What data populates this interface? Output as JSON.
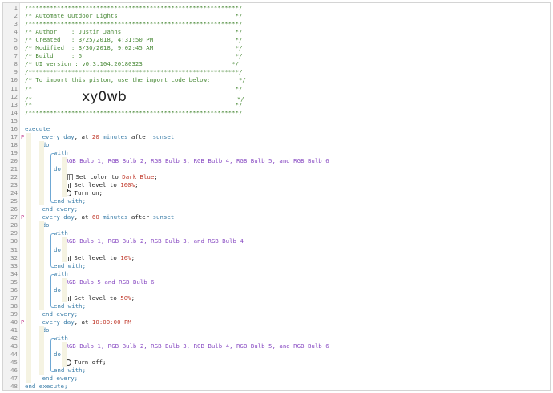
{
  "colors": {
    "comment": "#4a8a38",
    "keyword": "#3a7da8",
    "device": "#8b4fc4",
    "number": "#c0392b",
    "marker": "#c13a8a"
  },
  "header": {
    "rule_top": "/***********************************************************/",
    "title_line": "/* Automate Outdoor Lights                                 */",
    "rule_2": "/***********************************************************/",
    "author": "/* Author    : Justin Jahns                                */",
    "created": "/* Created   : 3/25/2018, 4:31:50 PM                       */",
    "modified": "/* Modified  : 3/30/2018, 9:02:45 AM                       */",
    "build": "/* Build     : 5                                           */",
    "ui_version": "/* UI version : v0.3.104.20180323                         */",
    "rule_3": "/***********************************************************/",
    "import_note": "/* To import this piston, use the import code below:        */",
    "blank_1": "/*                                                         */",
    "code_prefix": "/*",
    "import_code": "xy0wb",
    "code_suffix": "*/",
    "blank_2": "/*                                                         */",
    "rule_bottom": "/***********************************************************/"
  },
  "keywords": {
    "execute": "execute",
    "end_execute": "end execute;",
    "do": "do",
    "with": "with",
    "end_with": "end with;",
    "end_every": "end every;"
  },
  "blocks": [
    {
      "every": "every",
      "day": "day",
      "at": ", at",
      "time": "20",
      "unit": "minutes",
      "after": "after",
      "event": "sunset",
      "groups": [
        {
          "devices": "RGB Bulb 1, RGB Bulb 2, RGB Bulb 3, RGB Bulb 4, RGB Bulb 5, and RGB Bulb 6",
          "actions": [
            {
              "icon": "color-icon",
              "text": "Set color to",
              "value": "Dark Blue",
              "suffix": ";"
            },
            {
              "icon": "level-icon",
              "text": "Set level to",
              "value": "100%",
              "suffix": ";"
            },
            {
              "icon": "power-icon",
              "text": "Turn on;",
              "value": "",
              "suffix": ""
            }
          ]
        }
      ]
    },
    {
      "every": "every",
      "day": "day",
      "at": ", at",
      "time": "60",
      "unit": "minutes",
      "after": "after",
      "event": "sunset",
      "groups": [
        {
          "devices": "RGB Bulb 1, RGB Bulb 2, RGB Bulb 3, and RGB Bulb 4",
          "actions": [
            {
              "icon": "level-icon",
              "text": "Set level to",
              "value": "10%",
              "suffix": ";"
            }
          ]
        },
        {
          "devices": "RGB Bulb 5 and RGB Bulb 6",
          "actions": [
            {
              "icon": "level-icon",
              "text": "Set level to",
              "value": "50%",
              "suffix": ";"
            }
          ]
        }
      ]
    },
    {
      "every": "every",
      "day": "day",
      "at": ", at",
      "time": "10:00:00 PM",
      "unit": "",
      "after": "",
      "event": "",
      "groups": [
        {
          "devices": "RGB Bulb 1, RGB Bulb 2, RGB Bulb 3, RGB Bulb 4, RGB Bulb 5, and RGB Bulb 6",
          "actions": [
            {
              "icon": "power-off-icon",
              "text": "Turn off;",
              "value": "",
              "suffix": ""
            }
          ]
        }
      ]
    }
  ],
  "pause_marker": "P"
}
